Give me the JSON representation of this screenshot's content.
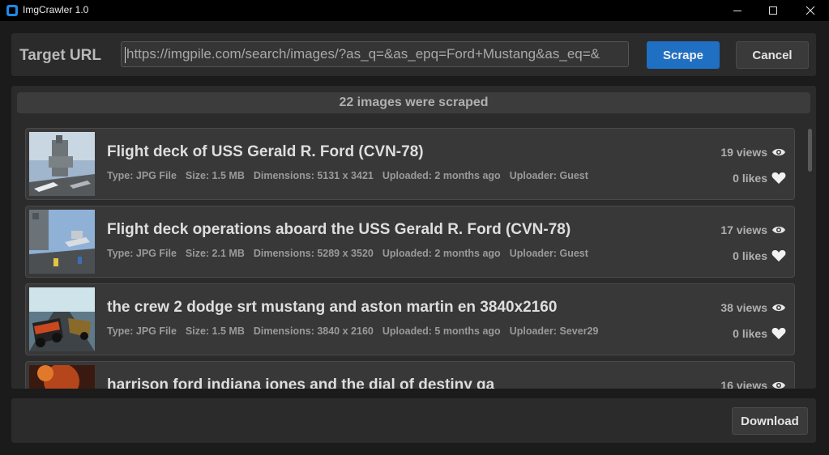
{
  "window": {
    "title": "ImgCrawler 1.0",
    "icons": [
      "app-icon",
      "minimize-icon",
      "maximize-icon",
      "close-icon"
    ]
  },
  "top": {
    "url_label": "Target URL",
    "url_value": "https://imgpile.com/search/images/?as_q=&as_epq=Ford+Mustang&as_eq=&",
    "scrape_label": "Scrape",
    "cancel_label": "Cancel",
    "accent_color": "#1f6fc2"
  },
  "results": {
    "header": "22 images were scraped",
    "items": [
      {
        "title": "Flight deck of USS Gerald R. Ford (CVN-78)",
        "type": "Type: JPG File",
        "size": "Size: 1.5 MB",
        "dimensions": "Dimensions: 5131 x 3421",
        "uploaded": "Uploaded: 2 months ago",
        "uploader": "Uploader: Guest",
        "views": "19 views",
        "likes": "0 likes"
      },
      {
        "title": "Flight deck operations aboard the USS Gerald R. Ford (CVN-78)",
        "type": "Type: JPG File",
        "size": "Size: 2.1 MB",
        "dimensions": "Dimensions: 5289 x 3520",
        "uploaded": "Uploaded: 2 months ago",
        "uploader": "Uploader: Guest",
        "views": "17 views",
        "likes": "0 likes"
      },
      {
        "title": "the crew 2 dodge srt mustang and aston martin en 3840x2160",
        "type": "Type: JPG File",
        "size": "Size: 1.5 MB",
        "dimensions": "Dimensions: 3840 x 2160",
        "uploaded": "Uploaded: 5 months ago",
        "uploader": "Uploader: Sever29",
        "views": "38 views",
        "likes": "0 likes"
      },
      {
        "title": "harrison ford indiana jones and the dial of destiny ga",
        "views": "16 views"
      }
    ]
  },
  "bottom": {
    "download_label": "Download"
  }
}
